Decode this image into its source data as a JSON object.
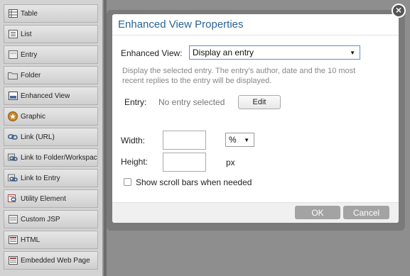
{
  "palette": {
    "items": [
      {
        "label": "Table",
        "icon": "table-icon"
      },
      {
        "label": "List",
        "icon": "list-icon"
      },
      {
        "label": "Entry",
        "icon": "entry-icon"
      },
      {
        "label": "Folder",
        "icon": "folder-icon"
      },
      {
        "label": "Enhanced View",
        "icon": "enhanced-view-icon"
      },
      {
        "label": "Graphic",
        "icon": "graphic-icon"
      },
      {
        "label": "Link (URL)",
        "icon": "link-icon"
      },
      {
        "label": "Link to Folder/Workspace",
        "icon": "link-icon"
      },
      {
        "label": "Link to Entry",
        "icon": "link-icon"
      },
      {
        "label": "Utility Element",
        "icon": "utility-icon"
      },
      {
        "label": "Custom JSP",
        "icon": "custom-jsp-icon"
      },
      {
        "label": "HTML",
        "icon": "html-icon"
      },
      {
        "label": "Embedded Web Page",
        "icon": "web-page-icon"
      }
    ]
  },
  "dialog": {
    "title": "Enhanced View Properties",
    "close_label": "×",
    "enhanced_view_label": "Enhanced View:",
    "enhanced_view_value": "Display an entry",
    "description": "Display the selected entry. The entry's author, date and the 10 most recent replies to the entry will be displayed.",
    "entry_label": "Entry:",
    "entry_value": "No entry selected",
    "edit_label": "Edit",
    "width_label": "Width:",
    "width_value": "",
    "width_unit": "%",
    "height_label": "Height:",
    "height_value": "",
    "height_unit": "px",
    "scrollbars_label": "Show scroll bars when needed",
    "scrollbars_checked": false,
    "ok_label": "OK",
    "cancel_label": "Cancel"
  }
}
